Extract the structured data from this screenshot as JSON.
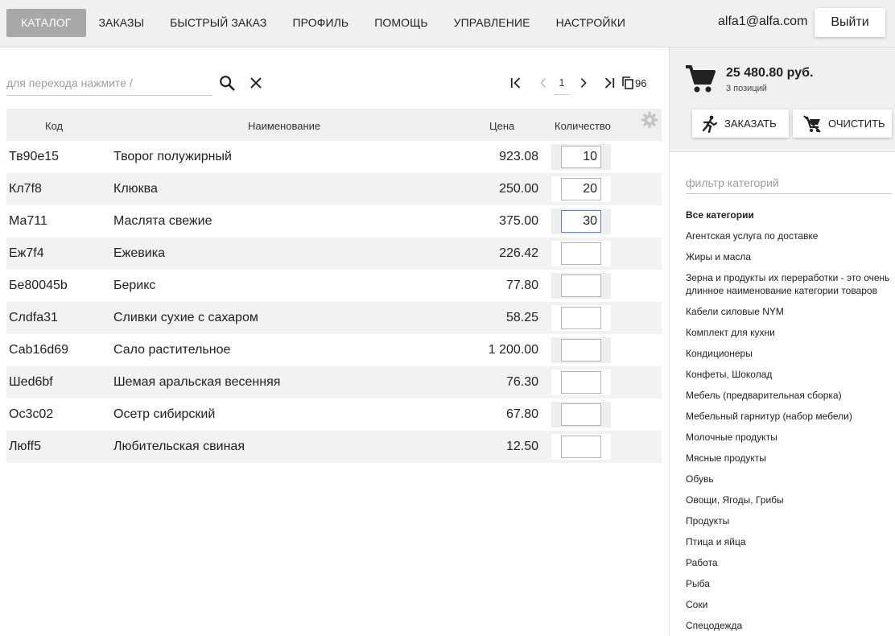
{
  "nav": {
    "items": [
      {
        "label": "КАТАЛОГ",
        "active": true
      },
      {
        "label": "ЗАКАЗЫ",
        "active": false
      },
      {
        "label": "БЫСТРЫЙ ЗАКАЗ",
        "active": false
      },
      {
        "label": "ПРОФИЛЬ",
        "active": false
      },
      {
        "label": "ПОМОЩЬ",
        "active": false
      },
      {
        "label": "УПРАВЛЕНИЕ",
        "active": false
      },
      {
        "label": "НАСТРОЙКИ",
        "active": false
      }
    ],
    "user_email": "alfa1@alfa.com",
    "logout_label": "Выйти"
  },
  "search": {
    "placeholder": "для перехода нажмите /",
    "value": ""
  },
  "pager": {
    "page": "1",
    "total": "96"
  },
  "table": {
    "headers": {
      "code": "Код",
      "name": "Наименование",
      "price": "Цена",
      "qty": "Количество"
    },
    "rows": [
      {
        "code": "Тв90е15",
        "name": "Творог полужирный",
        "price": "923.08",
        "qty": "10"
      },
      {
        "code": "Кл7f8",
        "name": "Клюква",
        "price": "250.00",
        "qty": "20"
      },
      {
        "code": "Ма711",
        "name": "Маслята свежие",
        "price": "375.00",
        "qty": "30"
      },
      {
        "code": "Еж7f4",
        "name": "Ежевика",
        "price": "226.42",
        "qty": ""
      },
      {
        "code": "Бе80045b",
        "name": "Берикс",
        "price": "77.80",
        "qty": ""
      },
      {
        "code": "Слdfa31",
        "name": "Сливки сухие с сахаром",
        "price": "58.25",
        "qty": ""
      },
      {
        "code": "Саb16d69",
        "name": "Сало растительное",
        "price": "1 200.00",
        "qty": ""
      },
      {
        "code": "Шеd6bf",
        "name": "Шемая аральская весенняя",
        "price": "76.30",
        "qty": ""
      },
      {
        "code": "Ос3с02",
        "name": "Осетр сибирский",
        "price": "67.80",
        "qty": ""
      },
      {
        "code": "Люff5",
        "name": "Любительская свиная",
        "price": "12.50",
        "qty": ""
      }
    ]
  },
  "cart": {
    "total": "25 480.80 руб.",
    "count": "3 позиций",
    "order_label": "ЗАКАЗАТЬ",
    "clear_label": "ОЧИСТИТЬ"
  },
  "categories": {
    "filter_placeholder": "фильтр категорий",
    "items": [
      "Все категории",
      "Агентская услуга по доставке",
      "Жиры и масла",
      "Зерна и продукты их переработки - это очень длинное наименование категории товаров",
      "Кабели силовые NYM",
      "Комплект для кухни",
      "Кондиционеры",
      "Конфеты, Шоколад",
      "Мебель (предварительная сборка)",
      "Мебельный гарнитур (набор мебели)",
      "Молочные продукты",
      "Мясные продукты",
      "Обувь",
      "Овощи, Ягоды, Грибы",
      "Продукты",
      "Птица и яйца",
      "Работа",
      "Рыба",
      "Соки",
      "Спецодежда"
    ]
  },
  "colors": {
    "nav_active_bg": "#a8a8a8",
    "focus_border": "#5b7bd6",
    "panel_bg": "#f0f0f0"
  }
}
